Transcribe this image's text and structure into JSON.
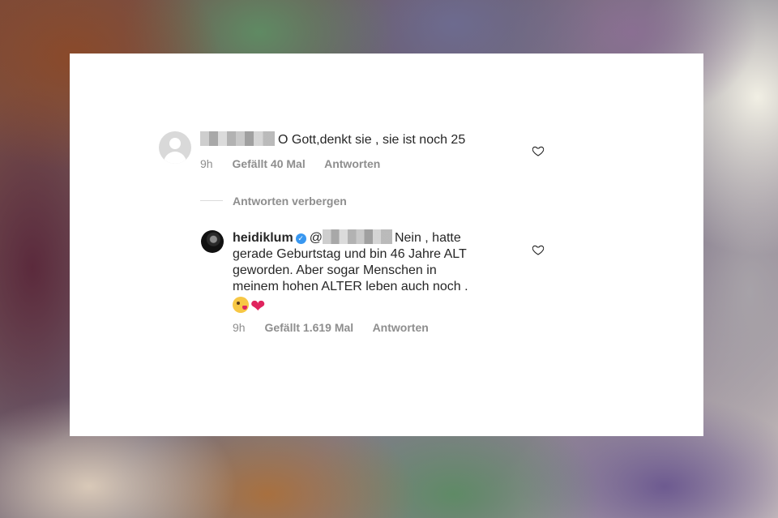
{
  "comments": [
    {
      "username_redacted": true,
      "text": "O Gott,denkt sie , sie ist noch 25",
      "time": "9h",
      "likes": "Gefällt 40 Mal",
      "reply": "Antworten",
      "like_icon": "heart-outline-icon"
    }
  ],
  "thread": {
    "hide_replies_label": "Antworten verbergen"
  },
  "reply_comment": {
    "username": "heidiklum",
    "verified_icon": "verified-badge-icon",
    "mention_prefix": "@",
    "text_line1": "Nein , hatte",
    "text_rest_line1": "gerade Geburtstag und bin 46 Jahre ALT",
    "text_rest_line2": "geworden. Aber sogar Menschen in",
    "text_rest_line3": "meinem hohen ALTER leben auch noch .",
    "emojis": [
      "kissing-face-icon",
      "red-heart-icon"
    ],
    "time": "9h",
    "likes": "Gefällt 1.619 Mal",
    "reply": "Antworten",
    "like_icon": "heart-outline-icon"
  },
  "colors": {
    "card_background": "#ffffff",
    "text_primary": "#262626",
    "text_secondary": "#8e8e8e",
    "verified_blue": "#3897f0"
  }
}
